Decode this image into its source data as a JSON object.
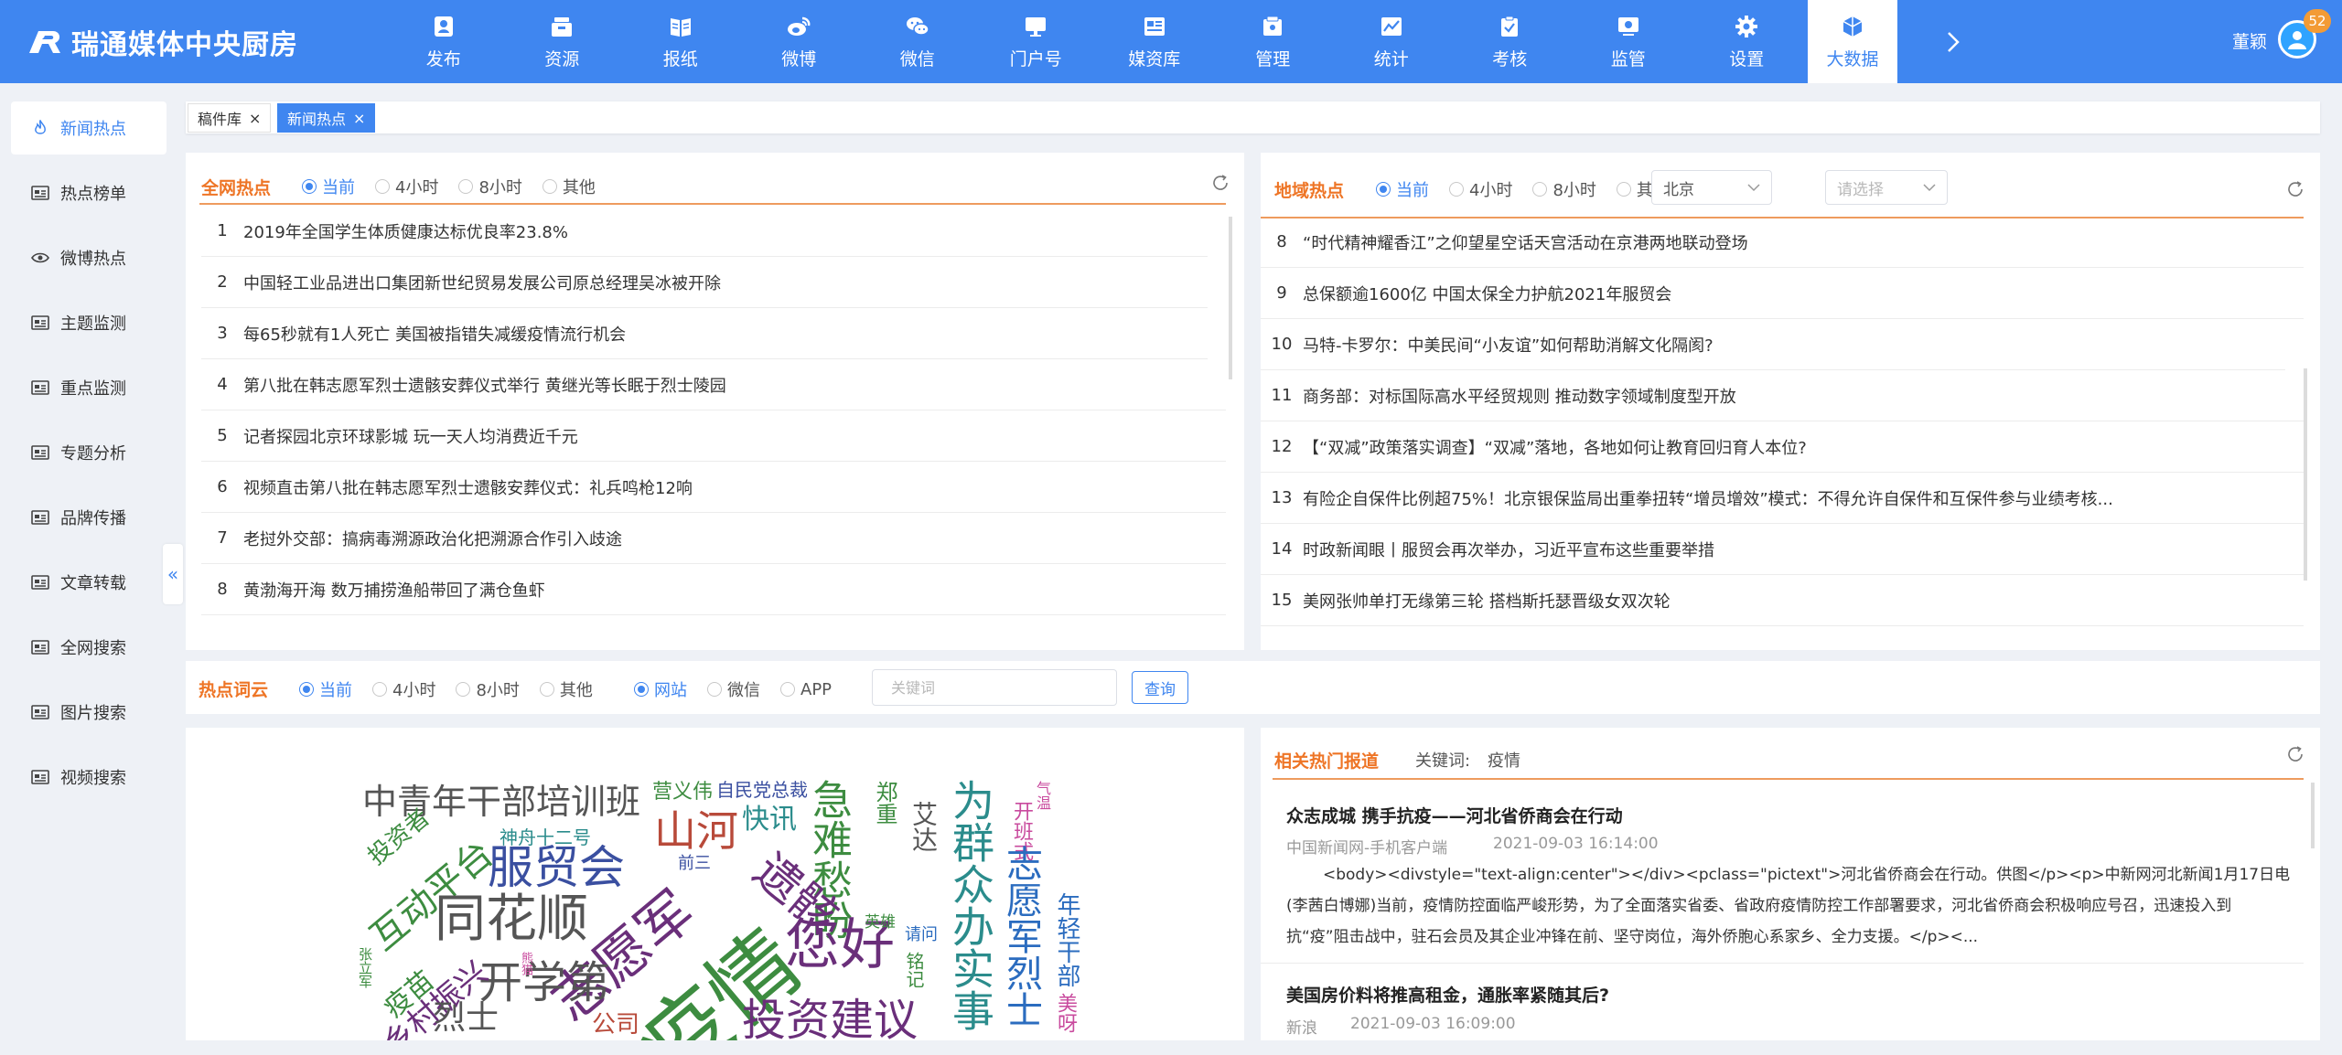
{
  "app": {
    "title": "瑞通媒体中央厨房"
  },
  "nav": {
    "items": [
      {
        "label": "发布",
        "icon": "user-badge-icon"
      },
      {
        "label": "资源",
        "icon": "box-icon"
      },
      {
        "label": "报纸",
        "icon": "book-icon"
      },
      {
        "label": "微博",
        "icon": "weibo-icon"
      },
      {
        "label": "微信",
        "icon": "wechat-icon"
      },
      {
        "label": "门户号",
        "icon": "monitor-icon"
      },
      {
        "label": "媒资库",
        "icon": "library-icon"
      },
      {
        "label": "管理",
        "icon": "manage-icon"
      },
      {
        "label": "统计",
        "icon": "chart-icon"
      },
      {
        "label": "考核",
        "icon": "clipboard-icon"
      },
      {
        "label": "监管",
        "icon": "supervise-icon"
      },
      {
        "label": "设置",
        "icon": "gear-icon"
      },
      {
        "label": "大数据",
        "icon": "cube-icon",
        "active": true
      }
    ]
  },
  "user": {
    "name": "董颖",
    "badge": "52"
  },
  "sidebar": {
    "items": [
      {
        "label": "新闻热点",
        "icon": "flame-icon",
        "active": true
      },
      {
        "label": "热点榜单",
        "icon": "card-icon"
      },
      {
        "label": "微博热点",
        "icon": "eye-icon"
      },
      {
        "label": "主题监测",
        "icon": "card-icon"
      },
      {
        "label": "重点监测",
        "icon": "card-icon"
      },
      {
        "label": "专题分析",
        "icon": "card-icon"
      },
      {
        "label": "品牌传播",
        "icon": "card-icon"
      },
      {
        "label": "文章转载",
        "icon": "card-icon"
      },
      {
        "label": "全网搜索",
        "icon": "card-icon"
      },
      {
        "label": "图片搜索",
        "icon": "card-icon"
      },
      {
        "label": "视频搜索",
        "icon": "card-icon"
      }
    ],
    "collapse_glyph": "«"
  },
  "tabs": [
    {
      "label": "稿件库",
      "close": "×"
    },
    {
      "label": "新闻热点",
      "close": "×",
      "active": true
    }
  ],
  "time_filters": [
    "当前",
    "4小时",
    "8小时",
    "其他"
  ],
  "national": {
    "title": "全网热点",
    "items": [
      {
        "num": "1",
        "text": "2019年全国学生体质健康达标优良率23.8%"
      },
      {
        "num": "2",
        "text": "中国轻工业品进出口集团新世纪贸易发展公司原总经理吴冰被开除"
      },
      {
        "num": "3",
        "text": "每65秒就有1人死亡 美国被指错失减缓疫情流行机会"
      },
      {
        "num": "4",
        "text": "第八批在韩志愿军烈士遗骸安葬仪式举行 黄继光等长眠于烈士陵园"
      },
      {
        "num": "5",
        "text": "记者探园北京环球影城 玩一天人均消费近千元"
      },
      {
        "num": "6",
        "text": "视频直击第八批在韩志愿军烈士遗骸安葬仪式：礼兵鸣枪12响"
      },
      {
        "num": "7",
        "text": "老挝外交部：搞病毒溯源政治化把溯源合作引入歧途"
      },
      {
        "num": "8",
        "text": "黄渤海开海 数万捕捞渔船带回了满仓鱼虾"
      }
    ]
  },
  "regional": {
    "title": "地域热点",
    "city": "北京",
    "district_placeholder": "请选择",
    "items": [
      {
        "num": "8",
        "text": "“时代精神耀香江”之仰望星空话天宫活动在京港两地联动登场"
      },
      {
        "num": "9",
        "text": "总保额逾1600亿 中国太保全力护航2021年服贸会"
      },
      {
        "num": "10",
        "text": "马特-卡罗尔：中美民间“小友谊”如何帮助消解文化隔阂?"
      },
      {
        "num": "11",
        "text": "商务部：对标国际高水平经贸规则 推动数字领域制度型开放"
      },
      {
        "num": "12",
        "text": "【“双减”政策落实调查】“双减”落地，各地如何让教育回归育人本位?"
      },
      {
        "num": "13",
        "text": "有险企自保件比例超75%！北京银保监局出重拳扭转“增员增效”模式：不得允许自保件和互保件参与业绩考核..."
      },
      {
        "num": "14",
        "text": "时政新闻眼丨服贸会再次举办，习近平宣布这些重要举措"
      },
      {
        "num": "15",
        "text": "美网张帅单打无缘第三轮 搭档斯托瑟晋级女双次轮"
      }
    ]
  },
  "wordcloud": {
    "title": "热点词云",
    "sources": [
      "网站",
      "微信",
      "APP"
    ],
    "keyword_placeholder": "关键词",
    "query_label": "查询",
    "words": [
      {
        "text": "中青年干部培训班",
        "color": "#555555"
      },
      {
        "text": "营义伟",
        "color": "#3d8c40"
      },
      {
        "text": "自民党总裁",
        "color": "#3a4fa0"
      },
      {
        "text": "急难愁盼",
        "color": "#3d8c40"
      },
      {
        "text": "郑重",
        "color": "#3d8c40"
      },
      {
        "text": "艾达",
        "color": "#555555"
      },
      {
        "text": "为群众办实事",
        "color": "#2b8c8c"
      },
      {
        "text": "气温",
        "color": "#c94b9e"
      },
      {
        "text": "开班式",
        "color": "#c94b9e"
      },
      {
        "text": "投资者",
        "color": "#3d8c40"
      },
      {
        "text": "神舟十二号",
        "color": "#2b8c8c"
      },
      {
        "text": "山河",
        "color": "#b84a3a"
      },
      {
        "text": "快讯",
        "color": "#2b8c8c"
      },
      {
        "text": "服贸会",
        "color": "#3a4fa0"
      },
      {
        "text": "互动平台",
        "color": "#3d8c40"
      },
      {
        "text": "遗骸",
        "color": "#6a2f7a"
      },
      {
        "text": "志愿军烈士",
        "color": "#2b6cbf"
      },
      {
        "text": "同花顺",
        "color": "#555555"
      },
      {
        "text": "志愿军",
        "color": "#6a2f7a"
      },
      {
        "text": "疫情",
        "color": "#3d8c40"
      },
      {
        "text": "您好",
        "color": "#6a2f7a"
      },
      {
        "text": "前三",
        "color": "#3a4fa0"
      },
      {
        "text": "英雄",
        "color": "#3d8c40"
      },
      {
        "text": "请问",
        "color": "#2b6cbf"
      },
      {
        "text": "铭记",
        "color": "#3d8c40"
      },
      {
        "text": "年轻干部",
        "color": "#2b6cbf"
      },
      {
        "text": "疫苗",
        "color": "#3d8c40"
      },
      {
        "text": "开学第",
        "color": "#555555"
      },
      {
        "text": "乡村振兴",
        "color": "#6a2f7a"
      },
      {
        "text": "张立军",
        "color": "#3d8c40"
      },
      {
        "text": "熊猫",
        "color": "#c94b9e"
      },
      {
        "text": "烈士",
        "color": "#555555"
      },
      {
        "text": "公司",
        "color": "#b84a3a"
      },
      {
        "text": "投资建议",
        "color": "#6a2f7a"
      },
      {
        "text": "美呀",
        "color": "#c94b9e"
      }
    ]
  },
  "related": {
    "title": "相关热门报道",
    "keyword_label": "关键词:",
    "keyword": "疫情",
    "items": [
      {
        "title": "众志成城 携手抗疫——河北省侨商会在行动",
        "source": "中国新闻网-手机客户端",
        "time": "2021-09-03 16:14:00",
        "body": "<body><divstyle=\"text-align:center\"></div><pclass=\"pictext\">河北省侨商会在行动。供图</p><p>中新网河北新闻1月17日电(李茜白博娜)当前，疫情防控面临严峻形势，为了全面落实省委、省政府疫情防控工作部署要求，河北省侨商会积极响应号召，迅速投入到抗“疫”阻击战中，驻石会员及其企业冲锋在前、坚守岗位，海外侨胞心系家乡、全力支援。</p><..."
      },
      {
        "title": "美国房价料将推高租金，通胀率紧随其后?",
        "source": "新浪",
        "time": "2021-09-03 16:09:00",
        "body": ""
      }
    ]
  },
  "colors": {
    "primary": "#3f86f0",
    "accent": "#ee7526",
    "badge": "#f39b35"
  }
}
